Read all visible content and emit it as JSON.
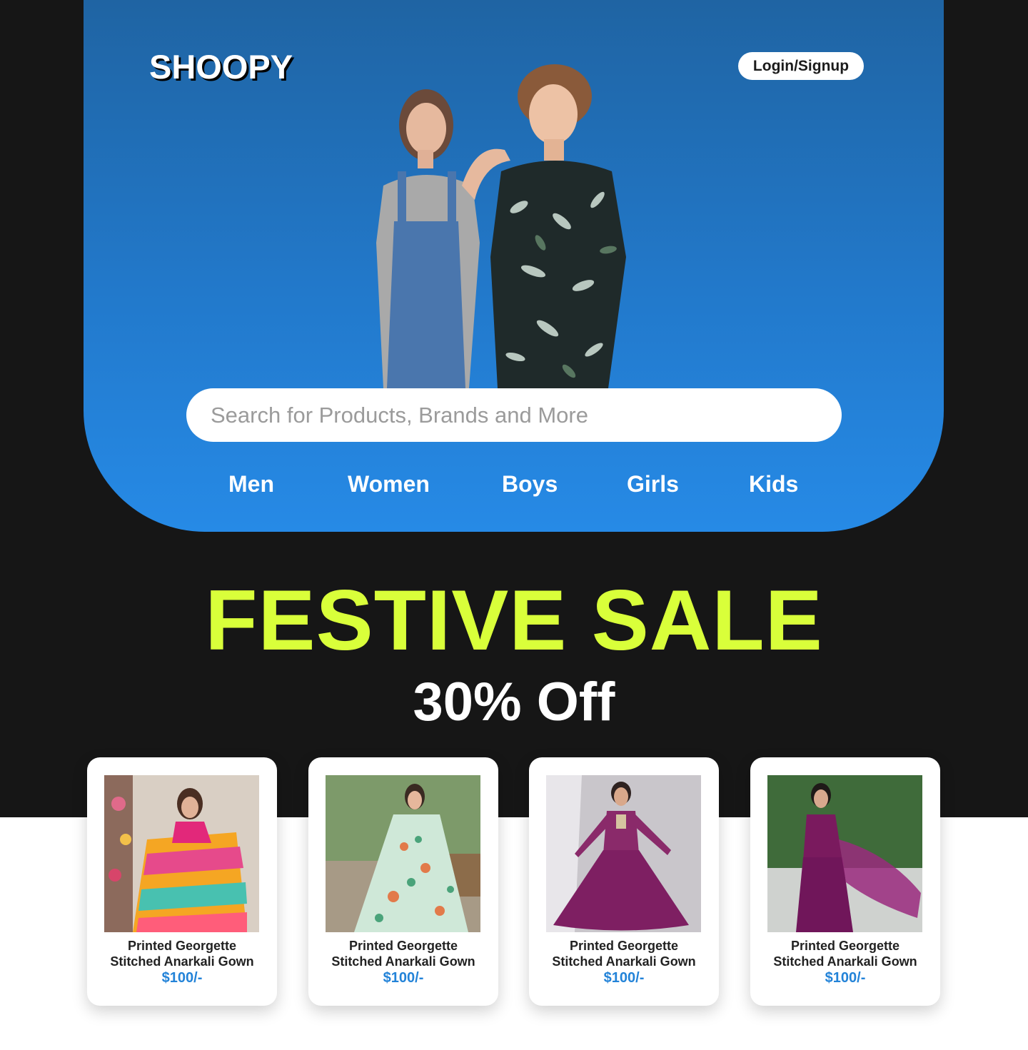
{
  "brand": {
    "logo": "SHOOPY"
  },
  "header": {
    "login_label": "Login/Signup"
  },
  "search": {
    "placeholder": "Search for Products, Brands and More"
  },
  "nav": {
    "items": [
      "Men",
      "Women",
      "Boys",
      "Girls",
      "Kids"
    ]
  },
  "promo": {
    "headline": "FESTIVE SALE",
    "discount": "30% Off"
  },
  "products": [
    {
      "title_line1": "Printed Georgette",
      "title_line2": "Stitched Anarkali Gown",
      "price": "$100/-"
    },
    {
      "title_line1": "Printed Georgette",
      "title_line2": "Stitched Anarkali Gown",
      "price": "$100/-"
    },
    {
      "title_line1": "Printed Georgette",
      "title_line2": "Stitched Anarkali Gown",
      "price": "$100/-"
    },
    {
      "title_line1": "Printed Georgette",
      "title_line2": "Stitched Anarkali Gown",
      "price": "$100/-"
    }
  ],
  "colors": {
    "page_dark": "#161616",
    "hero_blue": "#268ae6",
    "sale_accent": "#d9ff3a",
    "price_blue": "#2383d8"
  }
}
